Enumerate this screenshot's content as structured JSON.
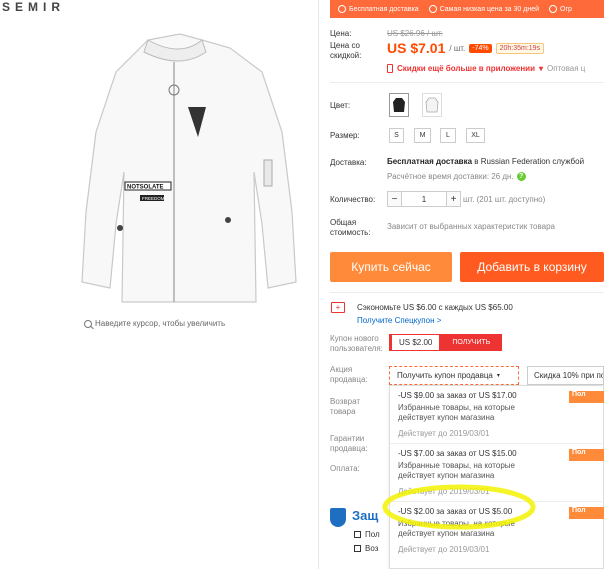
{
  "brand": "SEMIR",
  "zoom_hint": "Наведите курсор, чтобы увеличить",
  "banner": {
    "items": [
      "Бесплатная доставка",
      "Самая низкая цена за 30 дней",
      "Огр"
    ],
    "color": "#ff6a3a"
  },
  "price": {
    "label_price": "Цена:",
    "label_discount_price": "Цена со скидкой:",
    "old": "US $26.96 / шт.",
    "current": "US $7.01",
    "per": "/ шт.",
    "discount": "-74%",
    "timer": "20h:35m:19s",
    "app_promo": "Скидки ещё больше в приложении",
    "app_arrow": "▾",
    "wholesale": "Оптовая ц",
    "accent": "#ff4a00"
  },
  "options": {
    "color_label": "Цвет:",
    "size_label": "Размер:",
    "sizes": [
      "S",
      "M",
      "L",
      "XL"
    ]
  },
  "shipping": {
    "label": "Доставка:",
    "text_bold": "Бесплатная доставка",
    "text_rest": "в Russian Federation службой",
    "estimate": "Расчётное время доставки: 26 дн.",
    "help_icon": "?"
  },
  "quantity": {
    "label": "Количество:",
    "minus": "−",
    "value": "1",
    "plus": "+",
    "note": "шт. (201 шт. доступно)"
  },
  "total": {
    "label": "Общая стоимость:",
    "note": "Зависит от выбранных характеристик товара"
  },
  "buttons": {
    "buy": "Купить сейчас",
    "cart": "Добавить в корзину"
  },
  "savings": {
    "icon_text": "+",
    "text": "Сэкономьте US $6.00 с каждых US $65.00",
    "link": "Получите Спецкупон >"
  },
  "coupon_new": {
    "label": "Купон нового пользователя:",
    "amount": "US $2.00",
    "get": "ПОЛУЧИТЬ"
  },
  "seller_coupon": {
    "label": "Акция продавца:",
    "select": "Получить купон продавца",
    "arrow": "▾",
    "store_discount": "Скидка 10% при по"
  },
  "left_labels": {
    "returns": "Возврат товара",
    "guarantee": "Гарантии продавца:",
    "payment": "Оплата:"
  },
  "coupons": [
    {
      "title": "-US $9.00 за заказ от US $17.00",
      "desc": "Избранные товары, на которые действует купон магазина",
      "valid": "Действует до 2019/03/01",
      "btn": "Пол"
    },
    {
      "title": "-US $7.00 за заказ от US $15.00",
      "desc": "Избранные товары, на которые действует купон магазина",
      "valid": "Действует до 2019/03/01",
      "btn": "Пол"
    },
    {
      "title": "-US $2.00 за заказ от US $5.00",
      "desc": "Избранные товары, на которые действует купон магазина",
      "valid": "Действует до 2019/03/01",
      "btn": "Пол"
    }
  ],
  "protection": {
    "title": "Защ",
    "rows": [
      "Пол",
      "Воз"
    ]
  },
  "jacket_patches": {
    "top": "NOTSOLATE",
    "bottom": "FREEDOM"
  }
}
